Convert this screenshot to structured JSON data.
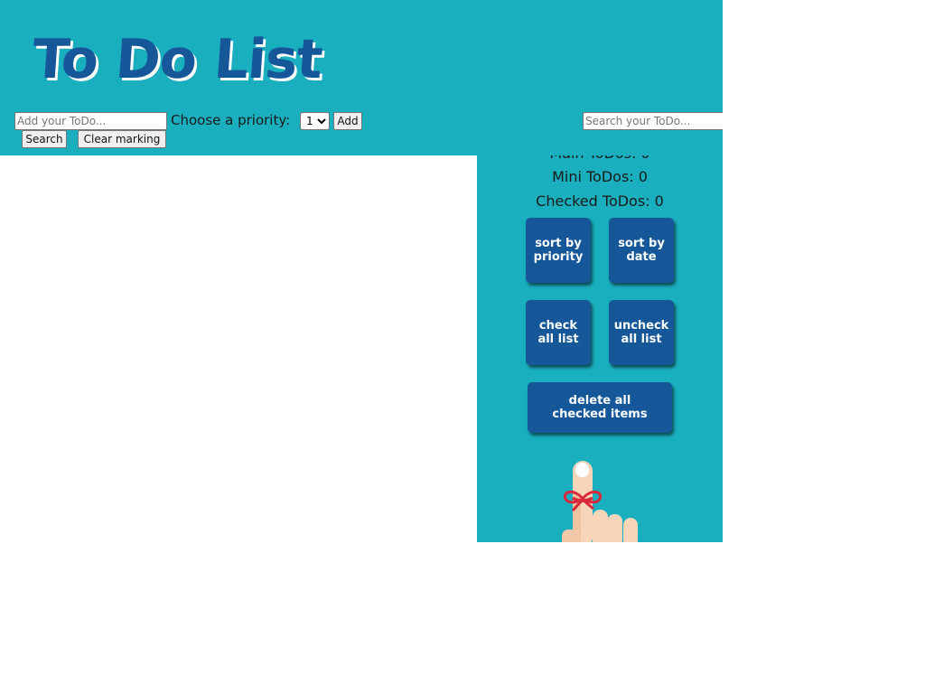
{
  "app": {
    "title": "To Do List"
  },
  "controls": {
    "add_placeholder": "Add your ToDo...",
    "priority_label": "Choose a priority:",
    "priority_selected": "1",
    "add_label": "Add",
    "search_placeholder": "Search your ToDo...",
    "search_label": "Search",
    "clear_label": "Clear marking"
  },
  "stats": {
    "main": "Main ToDos: 0",
    "mini": "Mini ToDos: 0",
    "checked": "Checked ToDos: 0"
  },
  "actions": {
    "sort_priority": "sort by priority",
    "sort_date": "sort by date",
    "check_all": "check all list",
    "uncheck_all": "uncheck all list",
    "delete_checked": "delete all checked items"
  },
  "colors": {
    "header_bg": "#1aafbe",
    "accent": "#16579a",
    "ribbon": "#d9283a"
  },
  "icons": {
    "illustration": "finger-with-ribbon-icon"
  }
}
